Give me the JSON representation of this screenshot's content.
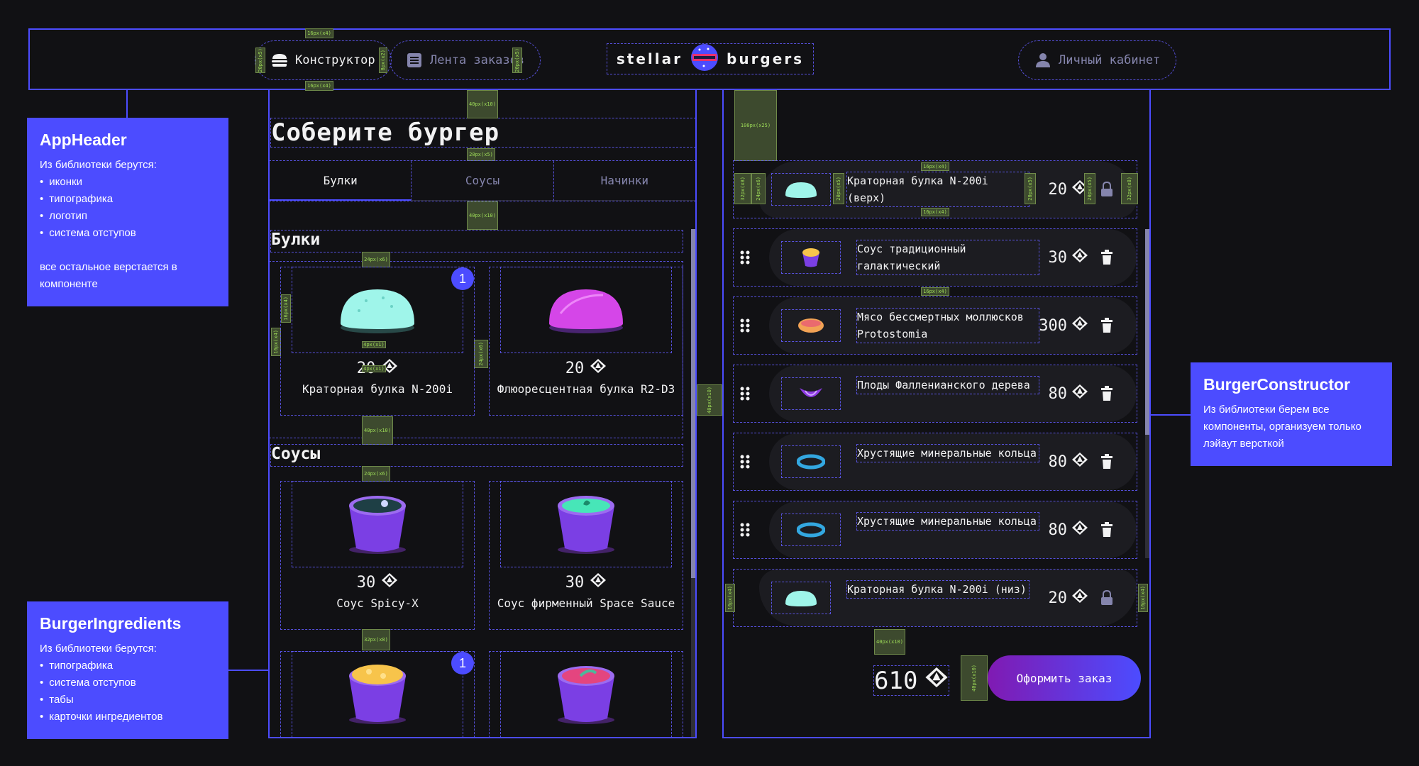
{
  "header": {
    "nav_constructor": "Конструктор",
    "nav_feed": "Лента заказов",
    "logo_left": "stellar",
    "logo_right": "burgers",
    "profile": "Личный кабинет"
  },
  "ingredients": {
    "title": "Соберите бургер",
    "tabs": [
      "Булки",
      "Соусы",
      "Начинки"
    ],
    "sections": [
      {
        "title": "Булки",
        "items": [
          {
            "name": "Краторная булка N-200i",
            "price": "20",
            "count": "1",
            "color": "#6FF3E4"
          },
          {
            "name": "Флюоресцентная булка R2-D3",
            "price": "20",
            "count": "",
            "color": "#D546E8"
          }
        ]
      },
      {
        "title": "Соусы",
        "items": [
          {
            "name": "Соус Spicy-X",
            "price": "30",
            "count": "",
            "color": "#1E3F45"
          },
          {
            "name": "Соус фирменный Space Sauce",
            "price": "30",
            "count": "",
            "color": "#47E6B8"
          },
          {
            "name": "",
            "price": "",
            "count": "1",
            "color": "#F7C44B"
          },
          {
            "name": "",
            "price": "",
            "count": "",
            "color": "#E4457F"
          }
        ]
      }
    ]
  },
  "constructor": {
    "top_bun": {
      "name": "Краторная булка N-200i (верх)",
      "price": "20"
    },
    "fillings": [
      {
        "name": "Соус традиционный галактический",
        "price": "30",
        "color": "#F7C44B"
      },
      {
        "name": "Мясо бессмертных моллюсков Protostomia",
        "price": "300",
        "color": "#F2A255"
      },
      {
        "name": "Плоды Фалленианского дерева",
        "price": "80",
        "color": "#8E3BE3"
      },
      {
        "name": "Хрустящие минеральные кольца",
        "price": "80",
        "color": "#33A7E0"
      },
      {
        "name": "Хрустящие минеральные кольца",
        "price": "80",
        "color": "#33A7E0"
      }
    ],
    "bottom_bun": {
      "name": "Краторная булка N-200i (низ)",
      "price": "20"
    },
    "total": "610",
    "order_button": "Оформить заказ"
  },
  "notes": {
    "app_header": {
      "title": "AppHeader",
      "lead": "Из библиотеки берутся:",
      "items": [
        "иконки",
        "типографика",
        "логотип",
        "система отступов"
      ],
      "tail": "все остальное верстается в компоненте"
    },
    "burger_ingredients": {
      "title": "BurgerIngredients",
      "lead": "Из библиотеки берутся:",
      "items": [
        "типографика",
        "система отступов",
        "табы",
        "карточки ингредиентов"
      ]
    },
    "burger_constructor": {
      "title": "BurgerConstructor",
      "text": "Из библиотеки берем все компоненты, организуем только лэйаут версткой"
    }
  },
  "spacers": {
    "nav_top": "16px(x4)",
    "nav_bottom": "16px(x4)",
    "nav_left": "20px(x5)",
    "nav_icon_gap": "8px(x2)",
    "nav_right": "20px(x5)",
    "title_top": "40px(x10)",
    "title_bottom": "20px(x5)",
    "tabs_bottom": "40px(x10)",
    "cards_top": "24px(x6)",
    "card_left": "16px(x4)",
    "card_inner": "16px(x4)",
    "card_price_top": "4px(x1)",
    "card_price_bottom": "4px(x1)",
    "card_gap": "24px(x6)",
    "section_gap": "40px(x10)",
    "sauces_top": "24px(x6)",
    "sauces_row_gap": "32px(x8)",
    "column_gap": "40px(x10)",
    "constructor_top": "100px(x25)",
    "bun_left": "32px(x8)",
    "bun_img": "24px(x6)",
    "bun_text": "20px(x5)",
    "bun_price": "20px(x5)",
    "bun_lock": "20px(x5)",
    "bun_right": "32px(x8)",
    "bun_top_gap": "16px(x4)",
    "bun_bottom_gap": "16px(x4)",
    "row_gap": "16px(x4)",
    "bottom_left": "16px(x4)",
    "bottom_right": "16px(x4)",
    "total_top": "40px(x10)",
    "total_gap": "40px(x10)"
  }
}
